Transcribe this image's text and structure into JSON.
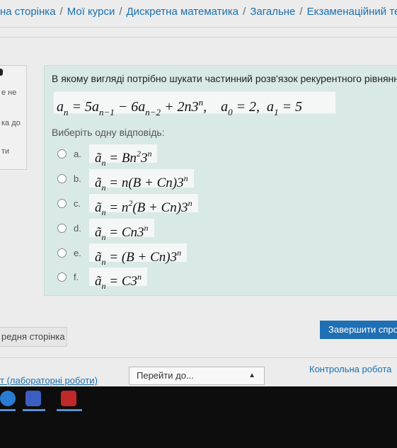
{
  "breadcrumb": [
    {
      "label": "на сторінка"
    },
    {
      "label": "Мої курси"
    },
    {
      "label": "Дискретна математика"
    },
    {
      "label": "Загальне"
    },
    {
      "label": "Екзаменаційний тес"
    }
  ],
  "info": {
    "line1": "е не",
    "line2": "ка до",
    "line3": "ти"
  },
  "question": {
    "text": "В якому вигляді потрібно шукати частинний розв'язок рекурентного рівняння",
    "prompt": "Виберіть одну відповідь:"
  },
  "options": [
    {
      "letter": "a."
    },
    {
      "letter": "b."
    },
    {
      "letter": "c."
    },
    {
      "letter": "d."
    },
    {
      "letter": "e."
    },
    {
      "letter": "f."
    }
  ],
  "navigation": {
    "prev_page": "редня сторінка",
    "finish": "Завершити спро",
    "prev_activity": "т (лабораторні роботи)",
    "jump_to": "Перейти до...",
    "next_activity": "Контрольна робота"
  },
  "colors": {
    "link": "#1a6fb0",
    "question_bg": "#d8e9e6",
    "finish_button": "#1f6fb5"
  }
}
